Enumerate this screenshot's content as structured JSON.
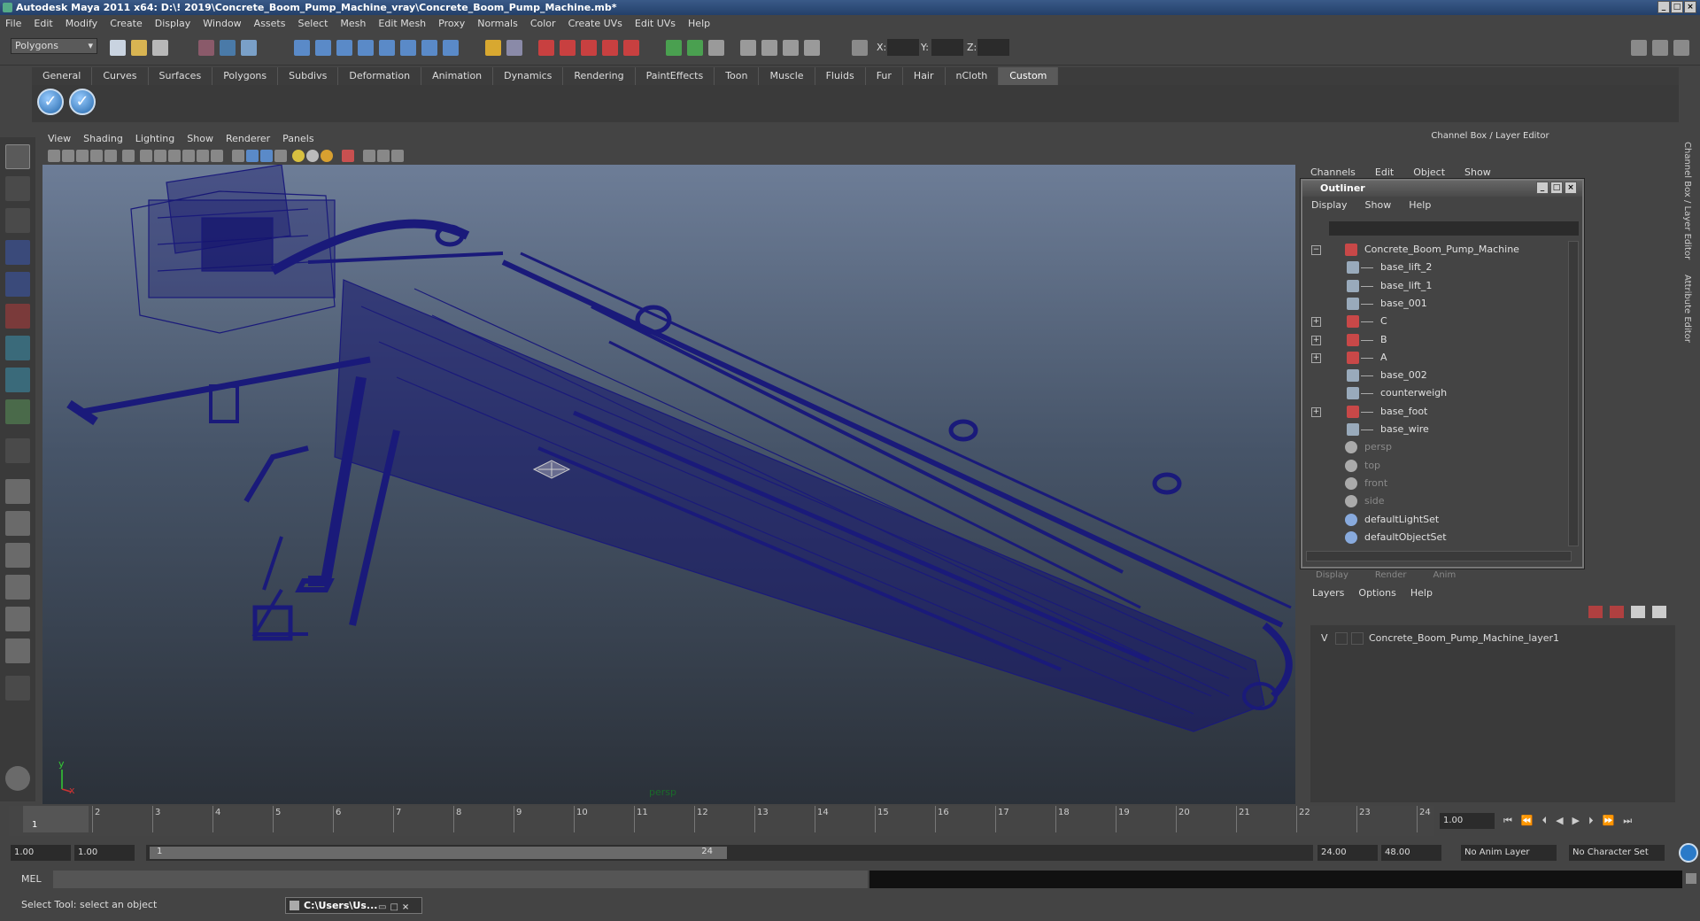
{
  "window": {
    "title": "Autodesk Maya 2011 x64: D:\\! 2019\\Concrete_Boom_Pump_Machine_vray\\Concrete_Boom_Pump_Machine.mb*"
  },
  "menubar": [
    "File",
    "Edit",
    "Modify",
    "Create",
    "Display",
    "Window",
    "Assets",
    "Select",
    "Mesh",
    "Edit Mesh",
    "Proxy",
    "Normals",
    "Color",
    "Create UVs",
    "Edit UVs",
    "Help"
  ],
  "statusline": {
    "mode": "Polygons",
    "x_label": "X:",
    "y_label": "Y:",
    "z_label": "Z:"
  },
  "shelf": {
    "tabs": [
      "General",
      "Curves",
      "Surfaces",
      "Polygons",
      "Subdivs",
      "Deformation",
      "Animation",
      "Dynamics",
      "Rendering",
      "PaintEffects",
      "Toon",
      "Muscle",
      "Fluids",
      "Fur",
      "Hair",
      "nCloth",
      "Custom"
    ],
    "active": "Custom"
  },
  "panel": {
    "menu": [
      "View",
      "Shading",
      "Lighting",
      "Show",
      "Renderer",
      "Panels"
    ],
    "camera_label": "persp",
    "axis_y": "y",
    "axis_x": "x"
  },
  "channelbox": {
    "header": "Channel Box / Layer Editor",
    "menu": [
      "Channels",
      "Edit",
      "Object",
      "Show"
    ],
    "side_tab_1": "Channel Box / Layer Editor",
    "side_tab_2": "Attribute Editor"
  },
  "outliner": {
    "title": "Outliner",
    "menu": [
      "Display",
      "Show",
      "Help"
    ],
    "items": [
      {
        "label": "Concrete_Boom_Pump_Machine",
        "type": "group",
        "expandable": true,
        "expanded": true,
        "indent": 0
      },
      {
        "label": "base_lift_2",
        "type": "mesh",
        "indent": 1
      },
      {
        "label": "base_lift_1",
        "type": "mesh",
        "indent": 1
      },
      {
        "label": "base_001",
        "type": "mesh",
        "indent": 1
      },
      {
        "label": "C",
        "type": "group",
        "expandable": true,
        "indent": 1
      },
      {
        "label": "B",
        "type": "group",
        "expandable": true,
        "indent": 1
      },
      {
        "label": "A",
        "type": "group",
        "expandable": true,
        "indent": 1
      },
      {
        "label": "base_002",
        "type": "mesh",
        "indent": 1
      },
      {
        "label": "counterweigh",
        "type": "mesh",
        "indent": 1
      },
      {
        "label": "base_foot",
        "type": "group",
        "expandable": true,
        "indent": 1
      },
      {
        "label": "base_wire",
        "type": "mesh",
        "indent": 1
      },
      {
        "label": "persp",
        "type": "camera",
        "dim": true,
        "indent": 0
      },
      {
        "label": "top",
        "type": "camera",
        "dim": true,
        "indent": 0
      },
      {
        "label": "front",
        "type": "camera",
        "dim": true,
        "indent": 0
      },
      {
        "label": "side",
        "type": "camera",
        "dim": true,
        "indent": 0
      },
      {
        "label": "defaultLightSet",
        "type": "set",
        "indent": 0
      },
      {
        "label": "defaultObjectSet",
        "type": "set",
        "indent": 0
      }
    ]
  },
  "layers": {
    "tabs": [
      "Display",
      "Render",
      "Anim"
    ],
    "menu": [
      "Layers",
      "Options",
      "Help"
    ],
    "rows": [
      {
        "visible": "V",
        "name": "Concrete_Boom_Pump_Machine_layer1"
      }
    ]
  },
  "timeslider": {
    "ticks": [
      "1",
      "2",
      "3",
      "4",
      "5",
      "6",
      "7",
      "8",
      "9",
      "10",
      "11",
      "12",
      "13",
      "14",
      "15",
      "16",
      "17",
      "18",
      "19",
      "20",
      "21",
      "22",
      "23",
      "24"
    ],
    "current_frame": "1.00",
    "current_marker": "1"
  },
  "range": {
    "start": "1.00",
    "start2": "1.00",
    "slider_start": "1",
    "slider_end": "24",
    "end": "24.00",
    "end2": "48.00",
    "anim_layer": "No Anim Layer",
    "char_set": "No Character Set"
  },
  "cmd": {
    "label": "MEL"
  },
  "help": {
    "text": "Select Tool: select an object"
  },
  "taskbar": {
    "label": "C:\\Users\\Us..."
  },
  "colors": {
    "wireframe": "#1a1a7a",
    "viewport_top": "#6d7d97",
    "viewport_bottom": "#2b3139"
  }
}
